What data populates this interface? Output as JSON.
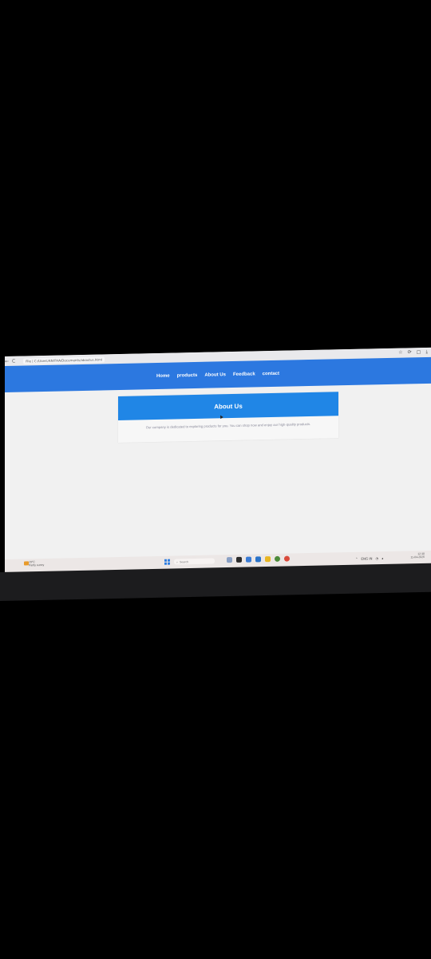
{
  "browser": {
    "url": "File | C:/Users/ANITHA/Documents/aboutus.html",
    "back_glyph": "←",
    "reload_glyph": "C",
    "right_icons": [
      "☆",
      "⟳",
      "▢",
      "⤓"
    ]
  },
  "nav": {
    "links": [
      "Home",
      "products",
      "About Us",
      "Feedback",
      "contact"
    ]
  },
  "about": {
    "title": "About Us",
    "text": "Our company is dedicated to exploring products for you. You can shop now and enjoy our high-quality products."
  },
  "taskbar": {
    "weather_temp": "29°C",
    "weather_text": "Partly sunny",
    "search_label": "Search",
    "clock_time": "12:30",
    "clock_date": "11-04-2025",
    "tray_lang": "ENG IN"
  },
  "colors": {
    "nav_bg": "#2c78e0",
    "header_bg": "#2086e6"
  }
}
